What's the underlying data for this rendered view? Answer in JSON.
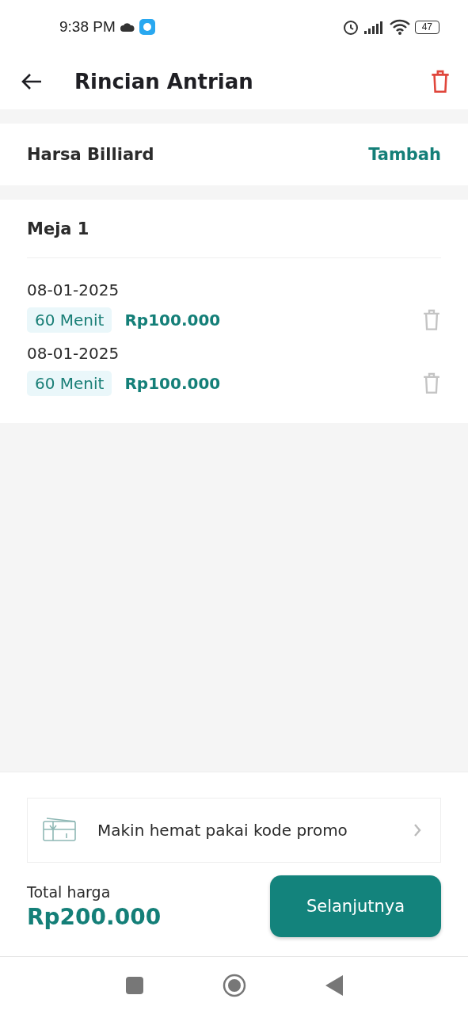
{
  "status_bar": {
    "time": "9:38 PM",
    "battery": "47"
  },
  "header": {
    "title": "Rincian Antrian"
  },
  "venue": {
    "name": "Harsa Billiard",
    "action": "Tambah"
  },
  "table": {
    "name": "Meja 1",
    "bookings": [
      {
        "date": "08-01-2025",
        "duration": "60 Menit",
        "price": "Rp100.000"
      },
      {
        "date": "08-01-2025",
        "duration": "60 Menit",
        "price": "Rp100.000"
      }
    ]
  },
  "promo": {
    "label": "Makin hemat pakai kode promo"
  },
  "total": {
    "label": "Total harga",
    "value": "Rp200.000"
  },
  "next_button": {
    "label": "Selanjutnya"
  }
}
